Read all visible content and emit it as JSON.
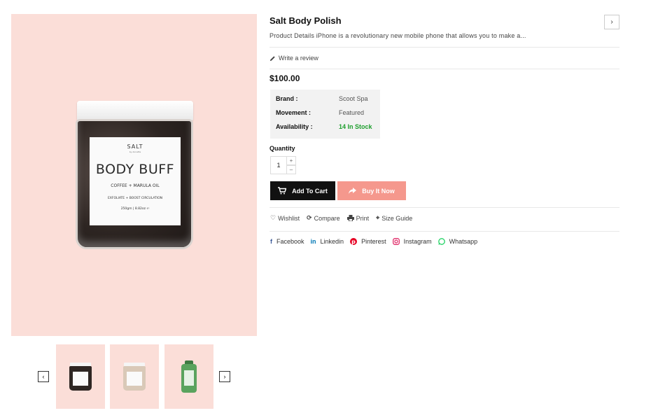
{
  "gallery": {
    "product_label": {
      "brand": "SALT",
      "brand_sub": "by Annette",
      "product": "BODY BUFF",
      "ingredients": "COFFEE + MARULA OIL",
      "benefit": "EXFOLIATE + BOOST CIRCULATION",
      "weight": "250gm | 8.82oz ℮"
    },
    "prev_icon": "‹",
    "next_icon": "›"
  },
  "product": {
    "title": "Salt Body Polish",
    "description": "Product Details iPhone is a revolutionary new mobile phone that allows you to make a...",
    "write_review": "Write a review",
    "price": "$100.00",
    "specs": [
      {
        "key": "Brand :",
        "value": "Scoot Spa"
      },
      {
        "key": "Movement :",
        "value": "Featured"
      },
      {
        "key": "Availability :",
        "value": "14 In Stock"
      }
    ],
    "quantity_label": "Quantity",
    "quantity_value": "1",
    "plus": "+",
    "minus": "–",
    "add_to_cart": "Add To Cart",
    "buy_now": "Buy It Now",
    "next_product": "›"
  },
  "actions": {
    "wishlist": "Wishlist",
    "compare": "Compare",
    "print": "Print",
    "size_guide": "Size Guide"
  },
  "social": {
    "facebook": "Facebook",
    "linkedin": "Linkedin",
    "pinterest": "Pinterest",
    "instagram": "Instagram",
    "whatsapp": "Whatsapp"
  },
  "colors": {
    "image_bg": "#fbded8",
    "buy_now_bg": "#f5988d",
    "cart_bg": "#111111",
    "in_stock": "#1d9e2d",
    "facebook": "#3b5998",
    "linkedin": "#0077b5",
    "pinterest": "#e60023",
    "instagram": "#e1306c",
    "whatsapp": "#25d366"
  }
}
